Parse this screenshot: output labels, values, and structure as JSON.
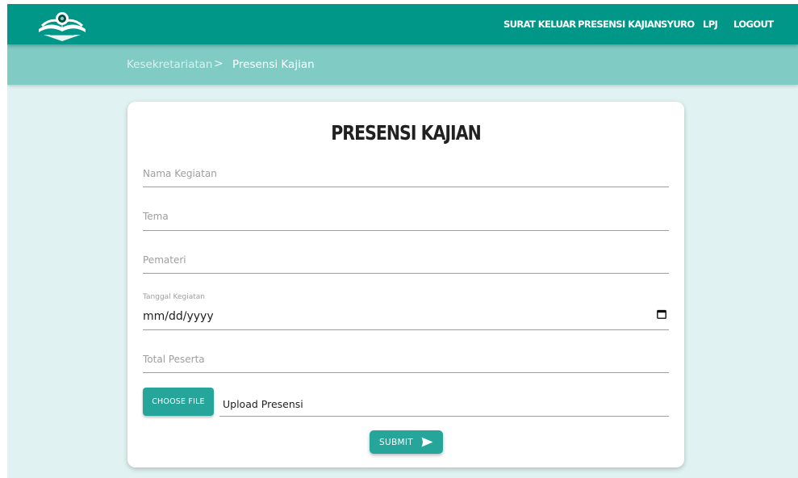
{
  "navbar": {
    "logo_icon": "open-book-logo",
    "links": [
      "SURAT KELUAR",
      "PRESENSI KAJIAN",
      "SYURO",
      "LPJ",
      "LOGOUT"
    ]
  },
  "breadcrumb": {
    "items": [
      "Kesekretariatan",
      "Presensi Kajian"
    ],
    "separator": ">"
  },
  "form": {
    "title": "PRESENSI KAJIAN",
    "nama_kegiatan": {
      "placeholder": "Nama Kegiatan",
      "value": ""
    },
    "tema": {
      "placeholder": "Tema",
      "value": ""
    },
    "pemateri": {
      "placeholder": "Pemateri",
      "value": ""
    },
    "tanggal": {
      "label": "Tanggal Kegiatan",
      "value": "mm/dd/yyyy",
      "icon": "calendar-icon"
    },
    "total_peserta": {
      "placeholder": "Total Peserta",
      "value": ""
    },
    "file": {
      "button_label": "CHOOSE FILE",
      "path_value": "Upload Presensi"
    },
    "submit": {
      "label": "SUBMIT",
      "icon": "send-icon"
    }
  },
  "colors": {
    "primary": "#009688",
    "secondary": "#80cbc4",
    "button": "#26a69a",
    "background": "#e0f2f1"
  }
}
